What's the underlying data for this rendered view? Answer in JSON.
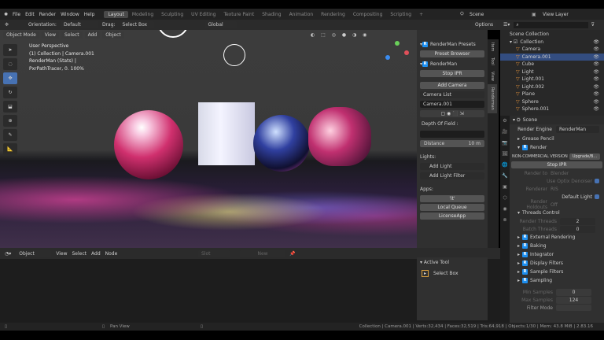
{
  "topbar": {
    "menus": [
      "File",
      "Edit",
      "Render",
      "Window",
      "Help"
    ],
    "workspaces": [
      "Layout",
      "Modeling",
      "Sculpting",
      "UV Editing",
      "Texture Paint",
      "Shading",
      "Animation",
      "Rendering",
      "Compositing",
      "Scripting",
      "+"
    ],
    "active_workspace": "Layout",
    "scene": "Scene",
    "view_layer": "View Layer"
  },
  "toolbar": {
    "orientation_label": "Orientation:",
    "orientation_value": "Default",
    "drag_label": "Drag:",
    "drag_value": "Select Box",
    "transform": "Global",
    "options": "Options"
  },
  "viewport": {
    "mode": "Object Mode",
    "menus": [
      "View",
      "Select",
      "Add",
      "Object"
    ],
    "overlay_lines": [
      "User Perspective",
      "(1) Collection | Camera.001",
      "RenderMan (Stats) |",
      "PxrPathTracer, 0. 100%"
    ]
  },
  "npanel": {
    "tabs": [
      "Item",
      "Tool",
      "View",
      "Renderman"
    ],
    "presets_title": "RenderMan Presets",
    "preset_browser": "Preset Browser",
    "renderman_title": "RenderMan",
    "stop_ipr": "Stop IPR",
    "add_camera": "Add Camera",
    "camera_list": "Camera List",
    "camera_name": "Camera.001",
    "dof_label": "Depth Of Field :",
    "distance_label": "Distance",
    "distance_value": "10 m",
    "lights_label": "Lights:",
    "add_light": "Add Light",
    "add_light_filter": "Add Light Filter",
    "apps_label": "Apps:",
    "app_it": "'it'",
    "local_queue": "Local Queue",
    "license_app": "LicenseApp"
  },
  "node_editor": {
    "type": "Object",
    "menus": [
      "View",
      "Select",
      "Add",
      "Node"
    ],
    "slot": "Slot",
    "new": "New",
    "active_tool_title": "Active Tool",
    "active_tool": "Select Box"
  },
  "outliner": {
    "root": "Scene Collection",
    "collection": "Collection",
    "items": [
      {
        "name": "Camera",
        "selected": false
      },
      {
        "name": "Camera.001",
        "selected": true
      },
      {
        "name": "Cube",
        "selected": false
      },
      {
        "name": "Light",
        "selected": false
      },
      {
        "name": "Light.001",
        "selected": false
      },
      {
        "name": "Light.002",
        "selected": false
      },
      {
        "name": "Plane",
        "selected": false
      },
      {
        "name": "Sphere",
        "selected": false
      },
      {
        "name": "Sphere.001",
        "selected": false
      }
    ]
  },
  "properties": {
    "context": "Scene",
    "render_engine_label": "Render Engine",
    "render_engine": "RenderMan",
    "grease_pencil": "Grease Pencil",
    "render": "Render",
    "license": "NON-COMMERCIAL VERSION",
    "upgrade": "Upgrade/B...",
    "stop_ipr": "Stop IPR",
    "render_to_label": "Render to",
    "render_to": "Blender",
    "optix": "Use Optix Denoiser",
    "renderer_label": "Renderer",
    "renderer": "RIS",
    "default_light": "Default Light",
    "holdouts_label": "Render Holdouts",
    "holdouts": "Off",
    "threads_control": "Threads Control",
    "render_threads_label": "Render Threads",
    "render_threads": "2",
    "batch_threads_label": "Batch Threads",
    "batch_threads": "0",
    "sections": [
      "External Rendering",
      "Baking",
      "Integrator",
      "Display Filters",
      "Sample Filters",
      "Sampling"
    ],
    "min_samples_label": "Min Samples",
    "min_samples": "0",
    "max_samples_label": "Max Samples",
    "max_samples": "124",
    "pixel_variance_label": "Filter Mode"
  },
  "statusbar": {
    "hint": "Pan View",
    "stats": "Collection | Camera.001 | Verts:32,434 | Faces:32,519 | Tris:64,918 | Objects:1/30 | Mem: 43.8 MiB | 2.83.16"
  },
  "colors": {
    "accent": "#4772b3",
    "selection": "#334d80",
    "renderman_blue": "#1d8ff0",
    "panel": "#303030",
    "header": "#232323"
  }
}
